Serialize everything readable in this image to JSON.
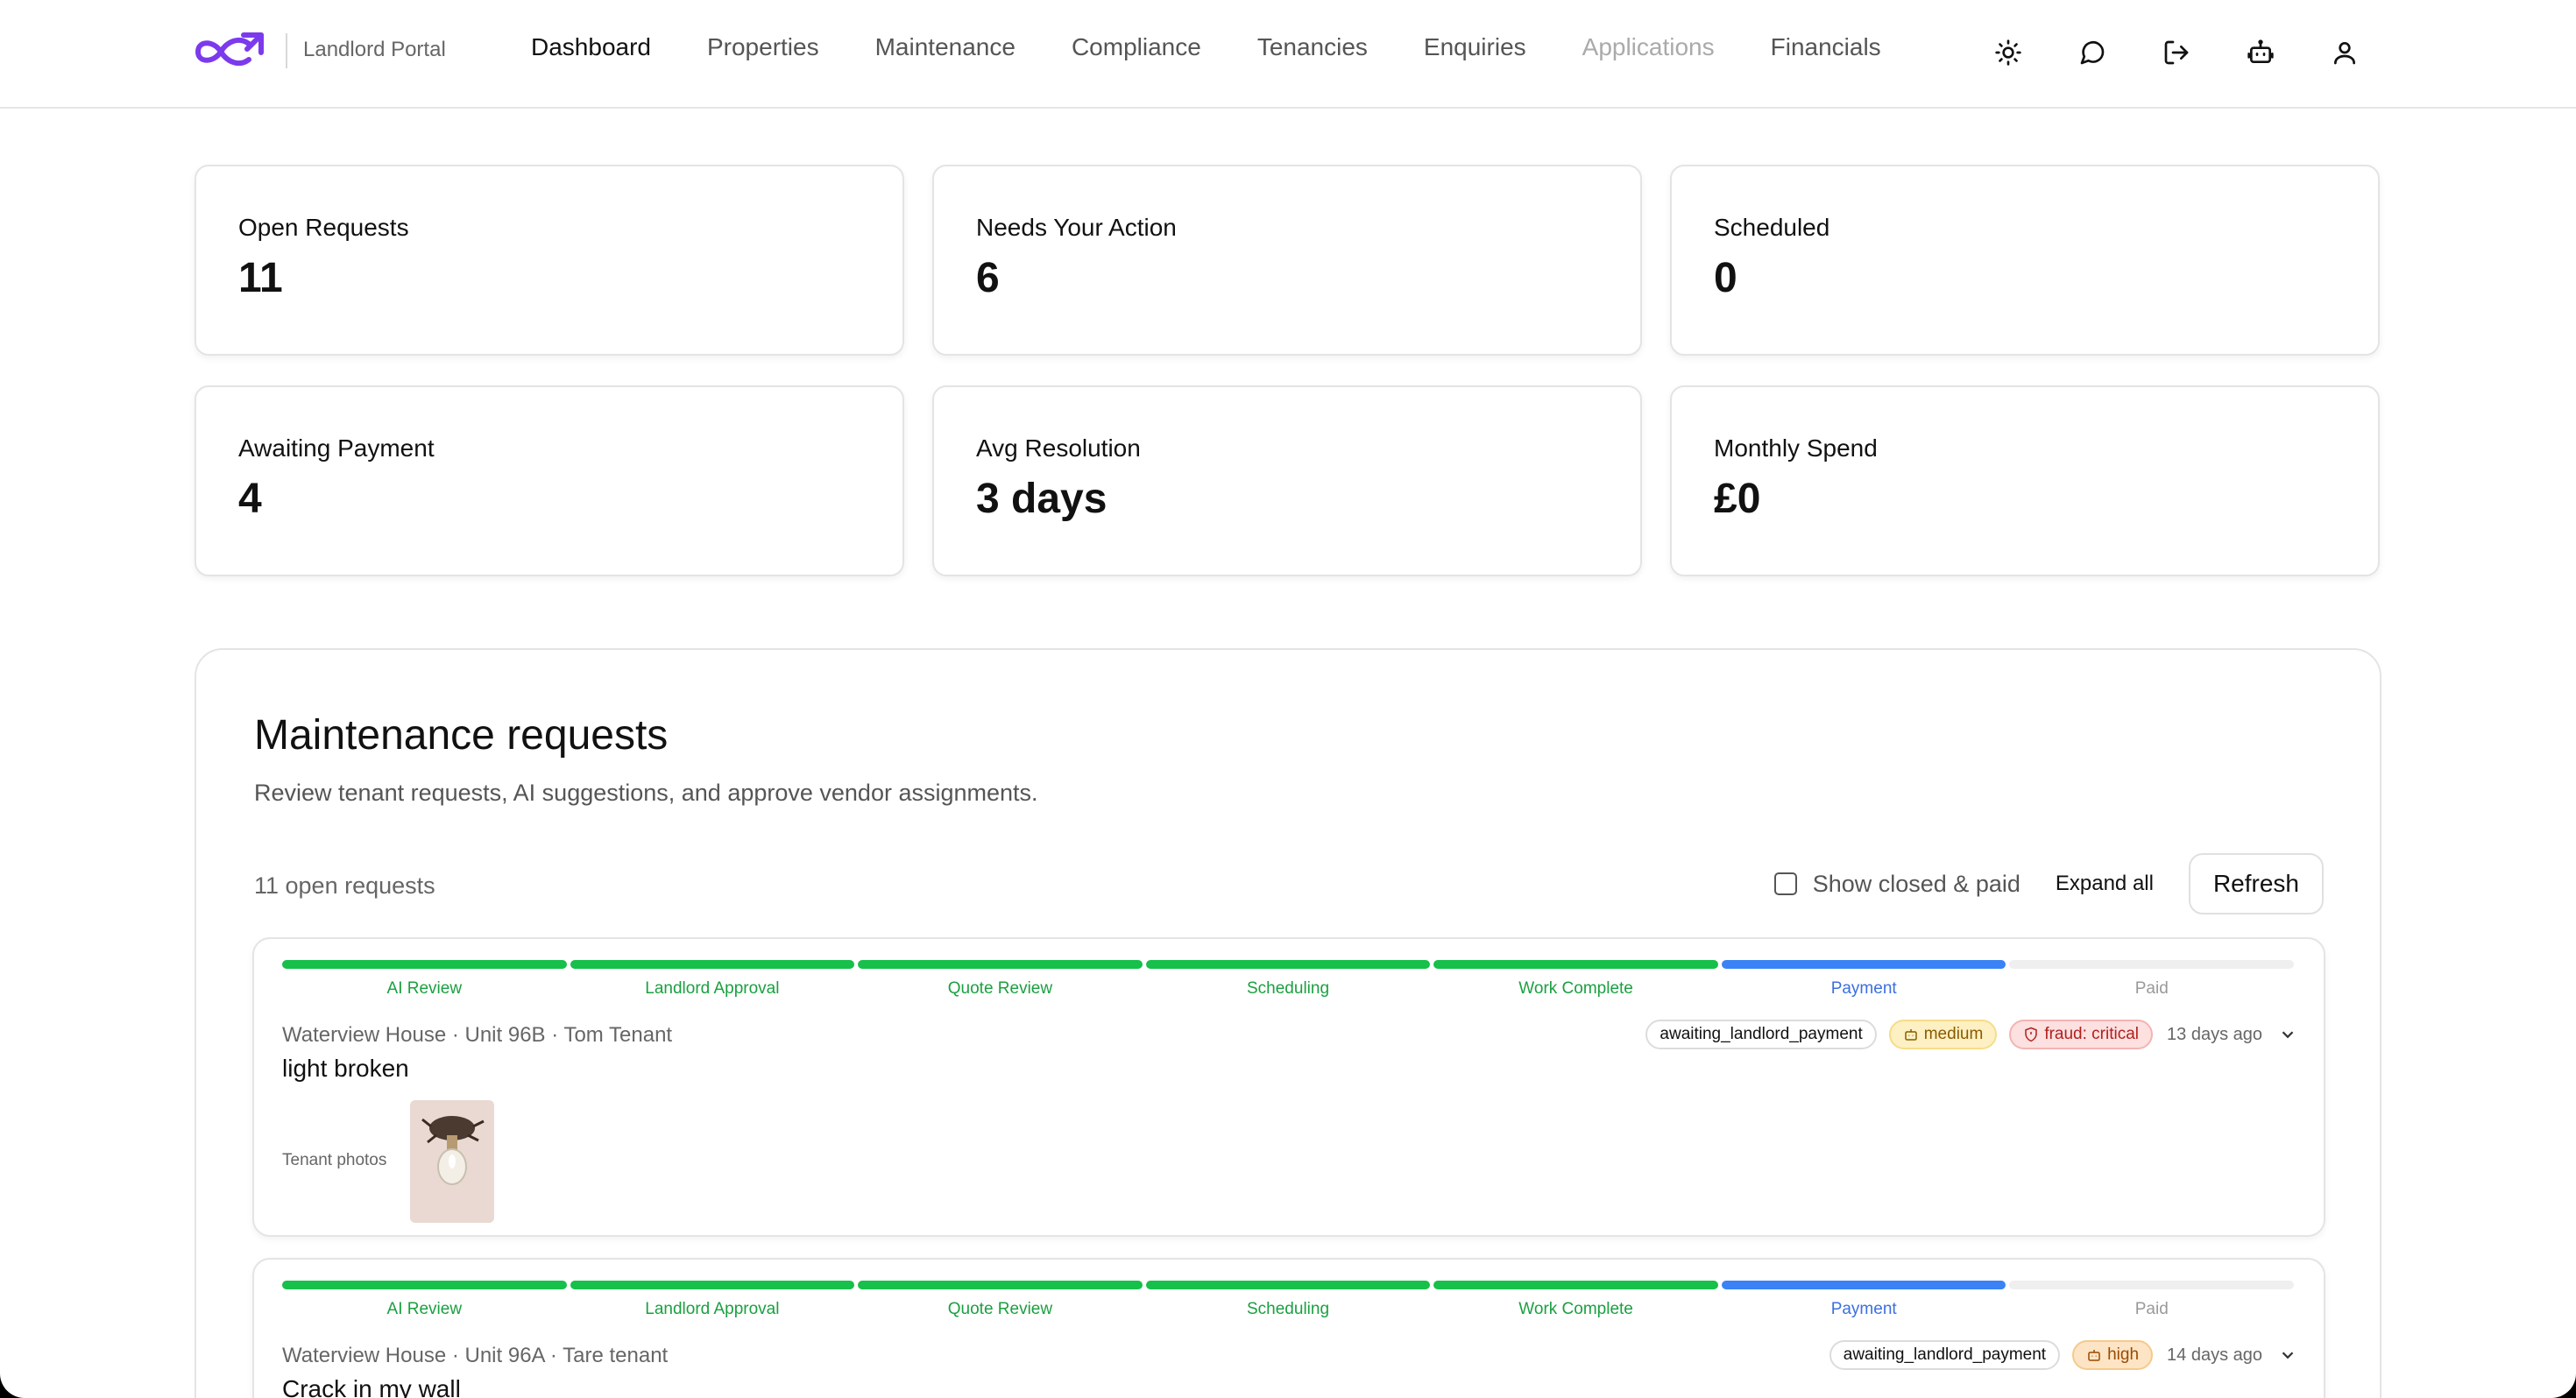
{
  "header": {
    "brand_label": "Landlord Portal",
    "nav": [
      {
        "label": "Dashboard",
        "state": "active"
      },
      {
        "label": "Properties",
        "state": "normal"
      },
      {
        "label": "Maintenance",
        "state": "normal"
      },
      {
        "label": "Compliance",
        "state": "normal"
      },
      {
        "label": "Tenancies",
        "state": "normal"
      },
      {
        "label": "Enquiries",
        "state": "normal"
      },
      {
        "label": "Applications",
        "state": "disabled"
      },
      {
        "label": "Financials",
        "state": "normal"
      }
    ],
    "icons": [
      "sun-icon",
      "chat-bubble-icon",
      "logout-icon",
      "robot-icon",
      "user-icon"
    ]
  },
  "stats": [
    {
      "label": "Open Requests",
      "value": "11"
    },
    {
      "label": "Needs Your Action",
      "value": "6"
    },
    {
      "label": "Scheduled",
      "value": "0"
    },
    {
      "label": "Awaiting Payment",
      "value": "4"
    },
    {
      "label": "Avg Resolution",
      "value": "3 days"
    },
    {
      "label": "Monthly Spend",
      "value": "£0"
    }
  ],
  "maintenance": {
    "title": "Maintenance requests",
    "subtitle": "Review tenant requests, AI suggestions, and approve vendor assignments.",
    "open_count": "11 open requests",
    "show_closed_label": "Show closed & paid",
    "show_closed_checked": false,
    "expand_all_label": "Expand all",
    "refresh_label": "Refresh",
    "stages": [
      "AI Review",
      "Landlord Approval",
      "Quote Review",
      "Scheduling",
      "Work Complete",
      "Payment",
      "Paid"
    ],
    "colors": {
      "done": "#16c04a",
      "current": "#3b82f6",
      "pending": "#efefef"
    },
    "requests": [
      {
        "meta": "Waterview House · Unit 96B · Tom Tenant",
        "title": "light broken",
        "status": "awaiting_landlord_payment",
        "priority": "medium",
        "fraud": "fraud: critical",
        "ago": "13 days ago",
        "completed_stages": 5,
        "current_stage": 5,
        "photos_label": "Tenant photos"
      },
      {
        "meta": "Waterview House · Unit 96A · Tare tenant",
        "title": "Crack in my wall",
        "status": "awaiting_landlord_payment",
        "priority": "high",
        "ago": "14 days ago",
        "completed_stages": 5,
        "current_stage": 5
      }
    ]
  }
}
